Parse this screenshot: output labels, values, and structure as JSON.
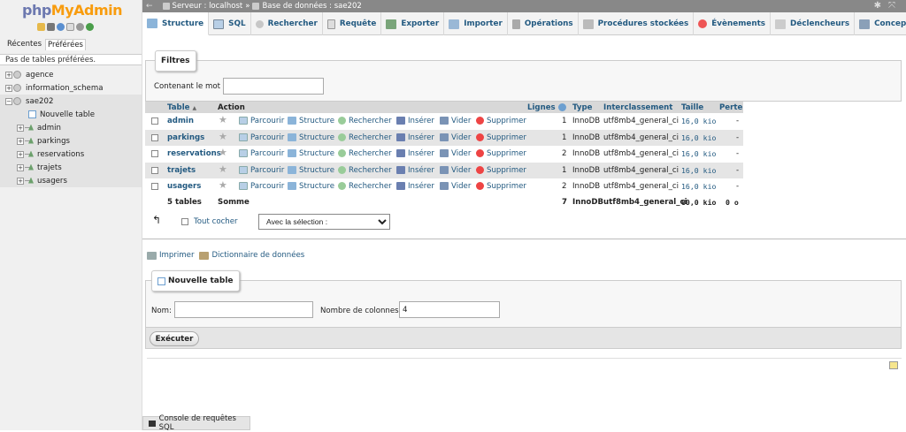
{
  "logo": {
    "part1": "php",
    "part2": "MyAdmin"
  },
  "left_tabs": {
    "recent": "Récentes",
    "favorites": "Préférées"
  },
  "favorites_text": "Pas de tables préférées.",
  "tree": {
    "dbs": [
      "agence",
      "information_schema",
      "sae202"
    ],
    "new_table": "Nouvelle table",
    "tables": [
      "admin",
      "parkings",
      "reservations",
      "trajets",
      "usagers"
    ]
  },
  "breadcrumb": {
    "server": "Serveur : localhost",
    "sep": "»",
    "database": "Base de données : sae202"
  },
  "tabs": [
    "Structure",
    "SQL",
    "Rechercher",
    "Requête",
    "Exporter",
    "Importer",
    "Opérations",
    "Procédures stockées",
    "Évènements",
    "Déclencheurs",
    "Concepteur"
  ],
  "filters": {
    "legend": "Filtres",
    "label": "Contenant le mot :",
    "value": ""
  },
  "table_headers": {
    "table": "Table",
    "sort": "▲",
    "action": "Action",
    "rows": "Lignes",
    "type": "Type",
    "collation": "Interclassement",
    "size": "Taille",
    "overhead": "Perte"
  },
  "actions": {
    "browse": "Parcourir",
    "structure": "Structure",
    "search": "Rechercher",
    "insert": "Insérer",
    "empty": "Vider",
    "drop": "Supprimer"
  },
  "tables": [
    {
      "name": "admin",
      "rows": "1",
      "type": "InnoDB",
      "collation": "utf8mb4_general_ci",
      "size": "16,0 kio",
      "overhead": "-"
    },
    {
      "name": "parkings",
      "rows": "1",
      "type": "InnoDB",
      "collation": "utf8mb4_general_ci",
      "size": "16,0 kio",
      "overhead": "-"
    },
    {
      "name": "reservations",
      "rows": "2",
      "type": "InnoDB",
      "collation": "utf8mb4_general_ci",
      "size": "16,0 kio",
      "overhead": "-"
    },
    {
      "name": "trajets",
      "rows": "1",
      "type": "InnoDB",
      "collation": "utf8mb4_general_ci",
      "size": "16,0 kio",
      "overhead": "-"
    },
    {
      "name": "usagers",
      "rows": "2",
      "type": "InnoDB",
      "collation": "utf8mb4_general_ci",
      "size": "16,0 kio",
      "overhead": "-"
    }
  ],
  "summary": {
    "count": "5 tables",
    "label": "Somme",
    "rows": "7",
    "type": "InnoDB",
    "collation": "utf8mb4_general_ci",
    "size": "80,0 kio",
    "overhead": "0 o"
  },
  "bulk": {
    "check_all": "Tout cocher",
    "with_selected": "Avec la sélection :"
  },
  "links": {
    "print": "Imprimer",
    "dictionary": "Dictionnaire de données"
  },
  "new_table": {
    "legend": "Nouvelle table",
    "name_label": "Nom:",
    "name_value": "",
    "cols_label": "Nombre de colonnes:",
    "cols_value": "4",
    "submit": "Exécuter"
  },
  "console": "Console de requêtes SQL",
  "colors": {
    "link": "#235a81",
    "logo_a": "#6c78af",
    "logo_b": "#f89c0e"
  }
}
